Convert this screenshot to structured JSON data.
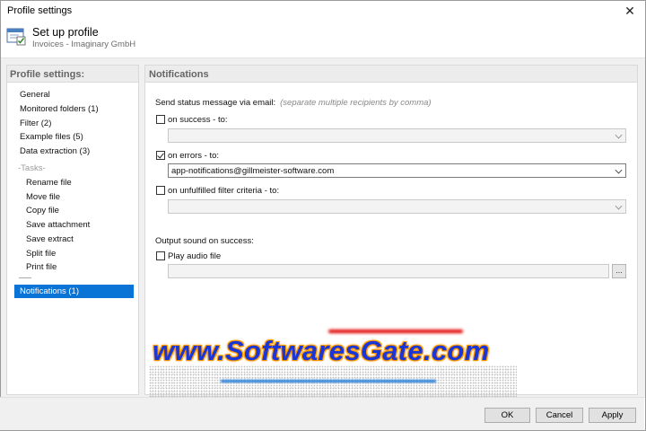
{
  "window": {
    "title": "Profile settings",
    "close_glyph": "✕"
  },
  "header": {
    "title": "Set up profile",
    "subtitle": "Invoices - Imaginary GmbH",
    "icon": "profile-settings-icon"
  },
  "left_panel": {
    "title": "Profile settings:",
    "items": [
      "General",
      "Monitored folders (1)",
      "Filter (2)",
      "Example files (5)",
      "Data extraction (3)"
    ],
    "tasks_header": "-Tasks-",
    "tasks": [
      "Rename file",
      "Move file",
      "Copy file",
      "Save attachment",
      "Save extract",
      "Split file",
      "Print file"
    ],
    "selected": "Notifications (1)"
  },
  "right_panel": {
    "title": "Notifications",
    "email_label": "Send status message via email:",
    "email_hint": "(separate multiple recipients by comma)",
    "on_success": {
      "label": "on success - to:",
      "checked": false,
      "value": ""
    },
    "on_errors": {
      "label": "on errors - to:",
      "checked": true,
      "value": "app-notifications@gillmeister-software.com"
    },
    "on_unfulfilled": {
      "label": "on unfulfilled filter criteria - to:",
      "checked": false,
      "value": ""
    },
    "sound_label": "Output sound on success:",
    "play_audio": {
      "label": "Play audio file",
      "checked": false
    },
    "audio_path": "",
    "browse_label": "..."
  },
  "watermark": {
    "text": "www.SoftwaresGate.com"
  },
  "buttons": {
    "ok": "OK",
    "cancel": "Cancel",
    "apply": "Apply"
  }
}
